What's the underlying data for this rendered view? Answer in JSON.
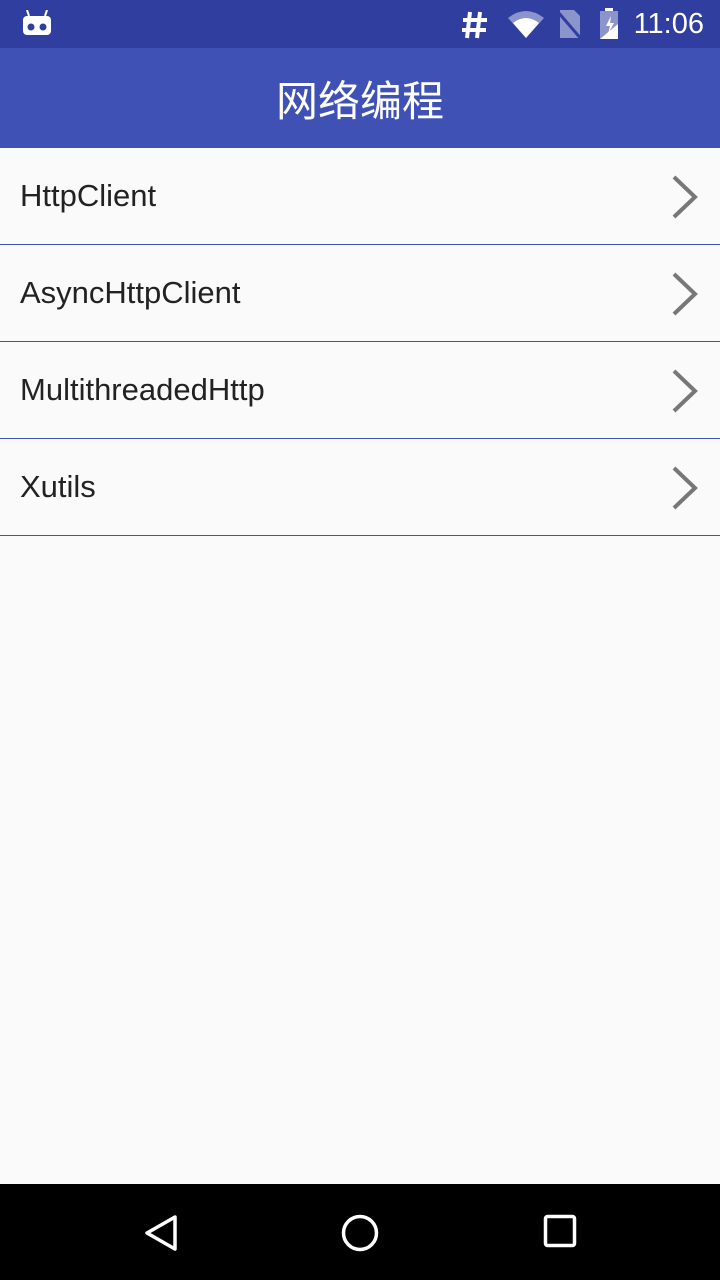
{
  "status_bar": {
    "time": "11:06",
    "icons": [
      "cyanogen-bot-icon",
      "hash-icon",
      "wifi-icon",
      "no-sim-icon",
      "battery-charging-icon"
    ]
  },
  "app_bar": {
    "title": "网络编程"
  },
  "list": {
    "items": [
      {
        "label": "HttpClient"
      },
      {
        "label": "AsyncHttpClient"
      },
      {
        "label": "MultithreadedHttp"
      },
      {
        "label": "Xutils"
      }
    ]
  },
  "colors": {
    "primary": "#3f51b5",
    "primary_dark": "#303f9f",
    "background": "#fafafa"
  },
  "nav_bar": {
    "buttons": [
      "back",
      "home",
      "recents"
    ]
  }
}
